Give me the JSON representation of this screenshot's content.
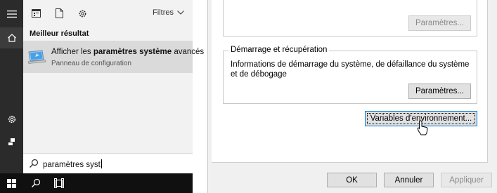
{
  "rail": {
    "icons": [
      "hamburger-icon",
      "home-icon",
      "gear-icon",
      "user-icon"
    ]
  },
  "toolbar": {
    "icons": [
      "apps-icon",
      "document-icon",
      "settings-icon"
    ],
    "filters_label": "Filtres"
  },
  "best_match": {
    "label": "Meilleur résultat",
    "title_prefix": "Afficher les ",
    "title_bold": "paramètres système",
    "title_suffix": " avancés",
    "subtitle": "Panneau de configuration"
  },
  "search": {
    "value": "paramètres syst"
  },
  "taskbar": {
    "icons": [
      "windows-icon",
      "search-icon",
      "task-view-icon"
    ]
  },
  "dialog": {
    "top_settings_button": "Paramètres...",
    "startup_group_title": "Démarrage et récupération",
    "startup_desc": "Informations de démarrage du système, de défaillance du système et de débogage",
    "startup_settings_button": "Paramètres...",
    "env_vars_button": "Variables d'environnement...",
    "ok_button": "OK",
    "cancel_button": "Annuler",
    "apply_button": "Appliquer"
  },
  "colors": {
    "rail": "#2b2b2b",
    "panel": "#f2f2f2",
    "selected_result": "#dadada",
    "taskbar": "#101010",
    "dialog": "#f0f0f0",
    "focus_border": "#0078d7"
  }
}
